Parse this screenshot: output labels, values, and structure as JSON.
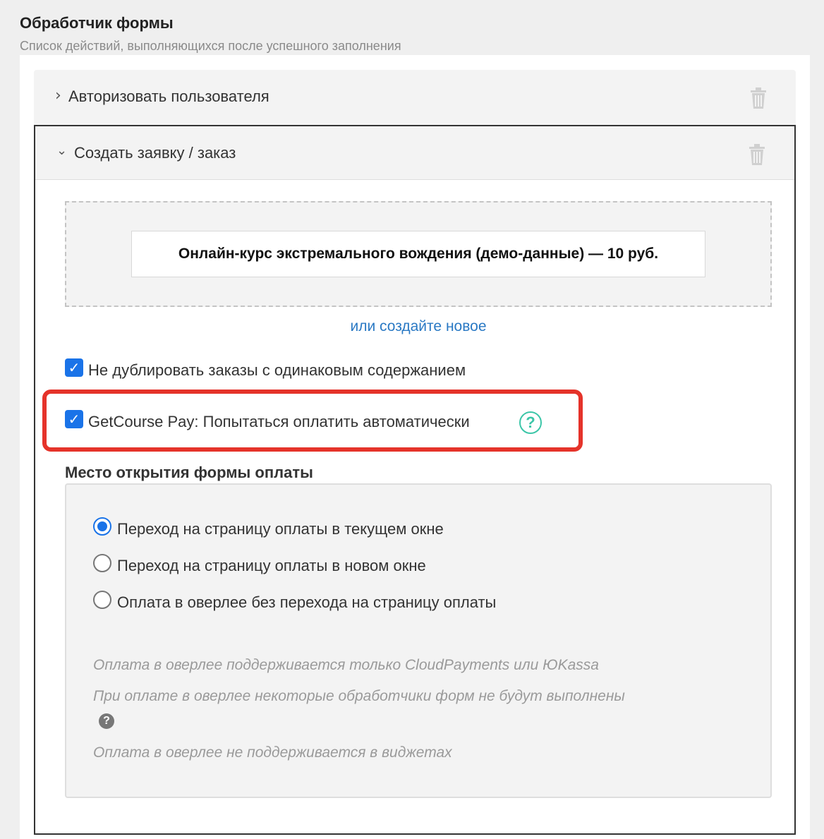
{
  "section": {
    "title": "Обработчик формы",
    "subtitle": "Список действий, выполняющихся после успешного заполнения"
  },
  "actions": [
    {
      "title": "Авторизовать пользователя",
      "expanded": false
    },
    {
      "title": "Создать заявку / заказ",
      "expanded": true
    }
  ],
  "order": {
    "offer": "Онлайн-курс экстремального вождения (демо-данные) — 10 руб.",
    "create_link": "или создайте новое",
    "no_duplicate_label": "Не дублировать заказы с одинаковым содержанием",
    "no_duplicate_checked": true,
    "autopay_label": "GetCourse Pay: Попытаться оплатить автоматически",
    "autopay_checked": true,
    "help_glyph": "?"
  },
  "payment_location": {
    "heading": "Место открытия формы оплаты",
    "options": [
      {
        "label": "Переход на страницу оплаты в текущем окне",
        "checked": true
      },
      {
        "label": "Переход на страницу оплаты в новом окне",
        "checked": false
      },
      {
        "label": "Оплата в оверлее без перехода на страницу оплаты",
        "checked": false
      }
    ],
    "notes": [
      "Оплата в оверлее поддерживается только CloudPayments или ЮKassa",
      "При оплате в оверлее некоторые обработчики форм не будут выполнены",
      "Оплата в оверлее не поддерживается в виджетах"
    ],
    "note_help_glyph": "?"
  },
  "colors": {
    "accent": "#1a73e8",
    "link": "#2a79c4",
    "highlight": "#e5332a",
    "help": "#3cc6a8"
  },
  "icons": {
    "trash": "trash-icon",
    "chevron_collapsed": "chevron-right-icon",
    "chevron_expanded": "chevron-down-icon",
    "checkmark": "checkmark-icon",
    "help": "question-circle-icon"
  }
}
